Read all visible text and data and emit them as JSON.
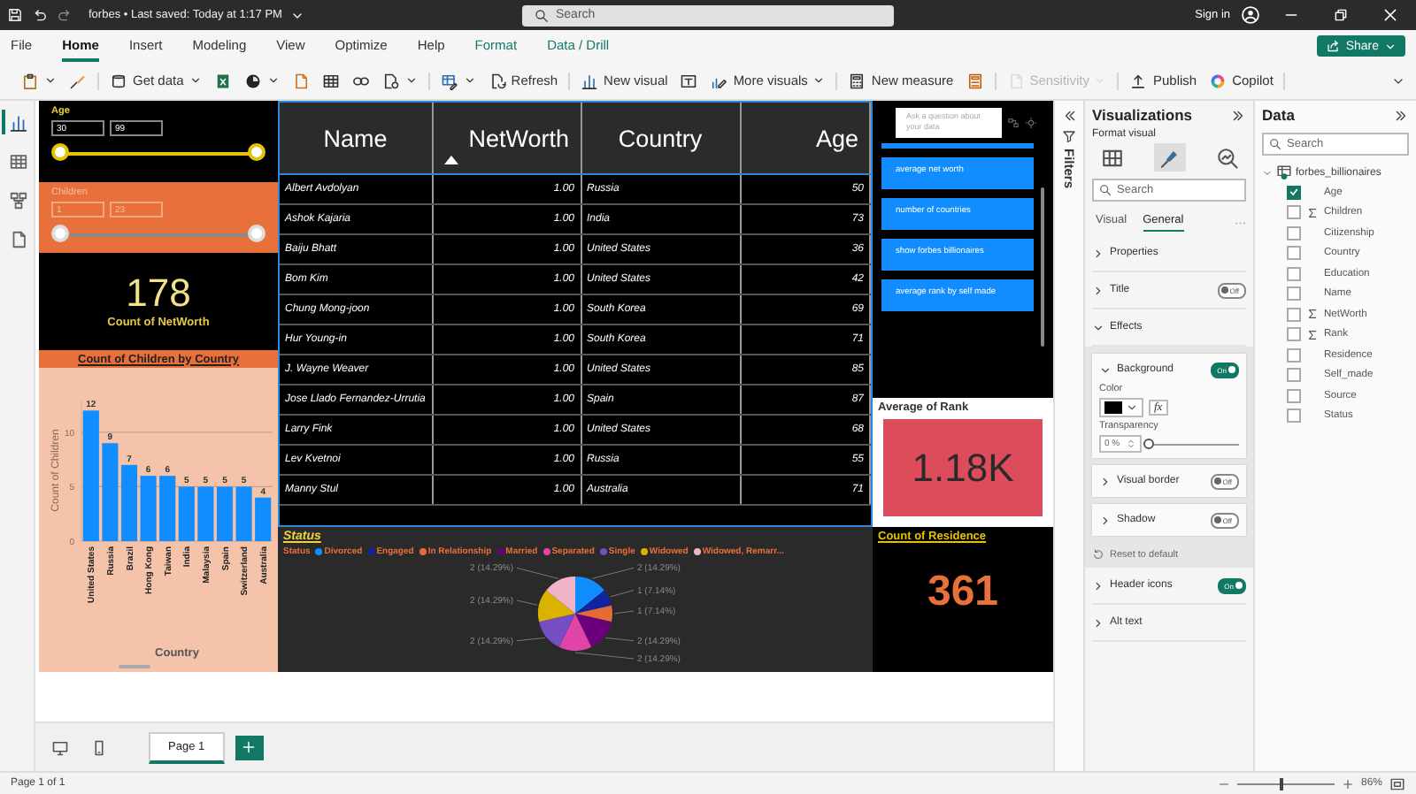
{
  "title_bar": {
    "document": "forbes • Last saved: Today at 1:17 PM",
    "search_placeholder": "Search",
    "sign_in": "Sign in"
  },
  "menu": [
    {
      "label": "File",
      "selected": false,
      "contextual": false
    },
    {
      "label": "Home",
      "selected": true,
      "contextual": false
    },
    {
      "label": "Insert",
      "selected": false,
      "contextual": false
    },
    {
      "label": "Modeling",
      "selected": false,
      "contextual": false
    },
    {
      "label": "View",
      "selected": false,
      "contextual": false
    },
    {
      "label": "Optimize",
      "selected": false,
      "contextual": false
    },
    {
      "label": "Help",
      "selected": false,
      "contextual": false
    },
    {
      "label": "Format",
      "selected": false,
      "contextual": true
    },
    {
      "label": "Data / Drill",
      "selected": false,
      "contextual": true
    }
  ],
  "share": "Share",
  "toolbar": [
    {
      "items": [
        {
          "dropdown": true,
          "disabled": false
        },
        {
          "dropdown": false,
          "disabled": false
        }
      ]
    },
    {
      "items": [
        {
          "label": "Get data",
          "dropdown": true,
          "disabled": false
        },
        {
          "dropdown": false,
          "disabled": false
        },
        {
          "dropdown": true,
          "disabled": false
        },
        {
          "dropdown": false,
          "disabled": false
        },
        {
          "dropdown": false,
          "disabled": false
        },
        {
          "dropdown": false,
          "disabled": false
        },
        {
          "dropdown": true,
          "disabled": false
        }
      ]
    },
    {
      "items": [
        {
          "dropdown": true,
          "disabled": false
        },
        {
          "label": "Refresh",
          "dropdown": false,
          "disabled": false
        }
      ]
    },
    {
      "items": [
        {
          "label": "New visual",
          "dropdown": false,
          "disabled": false
        },
        {
          "dropdown": false,
          "disabled": false
        },
        {
          "label": "More visuals",
          "dropdown": true,
          "disabled": false
        }
      ]
    },
    {
      "items": [
        {
          "label": "New measure",
          "dropdown": false,
          "disabled": false
        },
        {
          "dropdown": false,
          "disabled": false
        }
      ]
    },
    {
      "items": [
        {
          "label": "Sensitivity",
          "dropdown": true,
          "disabled": true
        }
      ]
    },
    {
      "items": [
        {
          "label": "Publish",
          "dropdown": false,
          "disabled": false
        },
        {
          "label": "Copilot",
          "dropdown": false,
          "disabled": false
        }
      ]
    }
  ],
  "rail": [
    {
      "selected": true
    },
    {
      "selected": false
    },
    {
      "selected": false
    },
    {
      "selected": false
    }
  ],
  "report": {
    "age_slicer": {
      "title": "Age",
      "min": "30",
      "max": "99",
      "handles": [
        {
          "level": 0
        },
        {
          "level": 1
        }
      ]
    },
    "children_slicer": {
      "title": "Children",
      "min": "1",
      "max": "23",
      "handles": [
        {
          "level": 0
        },
        {
          "level": 1
        }
      ]
    },
    "networth_card": {
      "value": "178",
      "label": "Count of NetWorth"
    },
    "children_chart": {
      "chart_data": {
        "type": "bar",
        "title": "Count of Children by Country",
        "xlabel": "Country",
        "ylabel": "Count of Children",
        "categories": [
          "United States",
          "Russia",
          "Brazil",
          "Hong Kong",
          "Taiwan",
          "India",
          "Malaysia",
          "Spain",
          "Switzerland",
          "Australia"
        ],
        "series": [
          {
            "color": "#118dff",
            "values": [
              12,
              9,
              7,
              6,
              6,
              5,
              5,
              5,
              5,
              4
            ]
          }
        ],
        "ylim": [
          0,
          13
        ],
        "yticks": [
          0,
          5,
          10
        ],
        "data_labels": true
      }
    },
    "table": {
      "columns": [
        {
          "label": "Name",
          "sorted": false,
          "kind": "text"
        },
        {
          "label": "NetWorth",
          "sorted": true,
          "kind": "number"
        },
        {
          "label": "Country",
          "sorted": false,
          "kind": "text"
        },
        {
          "label": "Age",
          "sorted": false,
          "kind": "number"
        }
      ],
      "rows": [
        [
          "Albert Avdolyan",
          "1.00",
          "Russia",
          "50"
        ],
        [
          "Ashok Kajaria",
          "1.00",
          "India",
          "73"
        ],
        [
          "Baiju Bhatt",
          "1.00",
          "United States",
          "36"
        ],
        [
          "Bom Kim",
          "1.00",
          "United States",
          "42"
        ],
        [
          "Chung Mong-joon",
          "1.00",
          "South Korea",
          "69"
        ],
        [
          "Hur Young-in",
          "1.00",
          "South Korea",
          "71"
        ],
        [
          "J. Wayne Weaver",
          "1.00",
          "United States",
          "85"
        ],
        [
          "Jose Llado Fernandez-Urrutia",
          "1.00",
          "Spain",
          "87"
        ],
        [
          "Larry Fink",
          "1.00",
          "United States",
          "68"
        ],
        [
          "Lev Kvetnoi",
          "1.00",
          "Russia",
          "55"
        ],
        [
          "Manny Stul",
          "1.00",
          "Australia",
          "71"
        ]
      ]
    },
    "qa": {
      "placeholder": "Ask a question about your data",
      "suggestions": [
        "average net worth",
        "number of countries",
        "show forbes billionaires",
        "average rank by self made"
      ]
    },
    "rank_card": {
      "title": "Average of Rank",
      "value": "1.18K"
    },
    "status_chart": {
      "title": "Status",
      "legend": {
        "title": "Status",
        "items": [
          {
            "label": "Divorced",
            "color": "#118dff"
          },
          {
            "label": "Engaged",
            "color": "#12239e"
          },
          {
            "label": "In Relationship",
            "color": "#e66c37"
          },
          {
            "label": "Married",
            "color": "#6b007b"
          },
          {
            "label": "Separated",
            "color": "#e044a7"
          },
          {
            "label": "Single",
            "color": "#744ec2"
          },
          {
            "label": "Widowed",
            "color": "#d9b300"
          },
          {
            "label": "Widowed, Remarr...",
            "color": "#f0b3c8"
          }
        ]
      },
      "chart_data": {
        "type": "pie",
        "values": [
          2,
          1,
          1,
          2,
          2,
          2,
          2,
          2
        ],
        "value_labels": [
          "2 (14.29%)",
          "1 (7.14%)",
          "1 (7.14%)",
          "2 (14.29%)",
          "2 (14.29%)",
          "2 (14.29%)",
          "2 (14.29%)",
          "2 (14.29%)"
        ]
      }
    },
    "residence_card": {
      "title": "Count of Residence",
      "value": "361"
    }
  },
  "filters": {
    "label": "Filters"
  },
  "viz": {
    "title": "Visualizations",
    "subtitle": "Format visual",
    "format_tabs": [
      {
        "selected": false
      },
      {
        "selected": true
      },
      {
        "selected": false
      }
    ],
    "search_placeholder": "Search",
    "tabs": [
      {
        "label": "Visual",
        "selected": false
      },
      {
        "label": "General",
        "selected": true
      }
    ],
    "more": "···",
    "sections": [
      {
        "label": "Properties",
        "expanded": false
      },
      {
        "label": "Title",
        "expanded": false,
        "toggle": {
          "on": false,
          "label": "Off"
        }
      },
      {
        "label": "Effects",
        "expanded": true
      }
    ],
    "effects": {
      "cards": [
        {
          "label": "Background",
          "expanded": true,
          "toggle": {
            "on": true,
            "label": "On"
          }
        },
        {
          "label": "Visual border",
          "expanded": false,
          "toggle": {
            "on": false,
            "label": "Off"
          }
        },
        {
          "label": "Shadow",
          "expanded": false,
          "toggle": {
            "on": false,
            "label": "Off"
          }
        }
      ],
      "color_label": "Color",
      "color": "#000000",
      "fx": "fx",
      "transparency_label": "Transparency",
      "transparency": "0 %",
      "transparency_slider": {
        "level": 0
      },
      "reset": "Reset to default"
    },
    "after": [
      {
        "label": "Header icons",
        "expanded": false,
        "toggle": {
          "on": true,
          "label": "On"
        }
      },
      {
        "label": "Alt text",
        "expanded": false
      }
    ]
  },
  "data": {
    "title": "Data",
    "search_placeholder": "Search",
    "tree": [
      {
        "label": "forbes_billionaires",
        "expanded": true,
        "children": [
          {
            "label": "Age",
            "checked": true,
            "kind": "field"
          },
          {
            "label": "Children",
            "checked": false,
            "kind": "sum"
          },
          {
            "label": "Citizenship",
            "checked": false,
            "kind": "field"
          },
          {
            "label": "Country",
            "checked": false,
            "kind": "field"
          },
          {
            "label": "Education",
            "checked": false,
            "kind": "field"
          },
          {
            "label": "Name",
            "checked": false,
            "kind": "field"
          },
          {
            "label": "NetWorth",
            "checked": false,
            "kind": "sum"
          },
          {
            "label": "Rank",
            "checked": false,
            "kind": "sum"
          },
          {
            "label": "Residence",
            "checked": false,
            "kind": "field"
          },
          {
            "label": "Self_made",
            "checked": false,
            "kind": "field"
          },
          {
            "label": "Source",
            "checked": false,
            "kind": "field"
          },
          {
            "label": "Status",
            "checked": false,
            "kind": "field"
          }
        ]
      }
    ]
  },
  "pages": [
    {
      "label": "Page 1",
      "selected": true
    }
  ],
  "status_bar": {
    "page_info": "Page 1 of 1",
    "zoom": "86%",
    "zoom_slider": {
      "level": 0.45
    }
  }
}
